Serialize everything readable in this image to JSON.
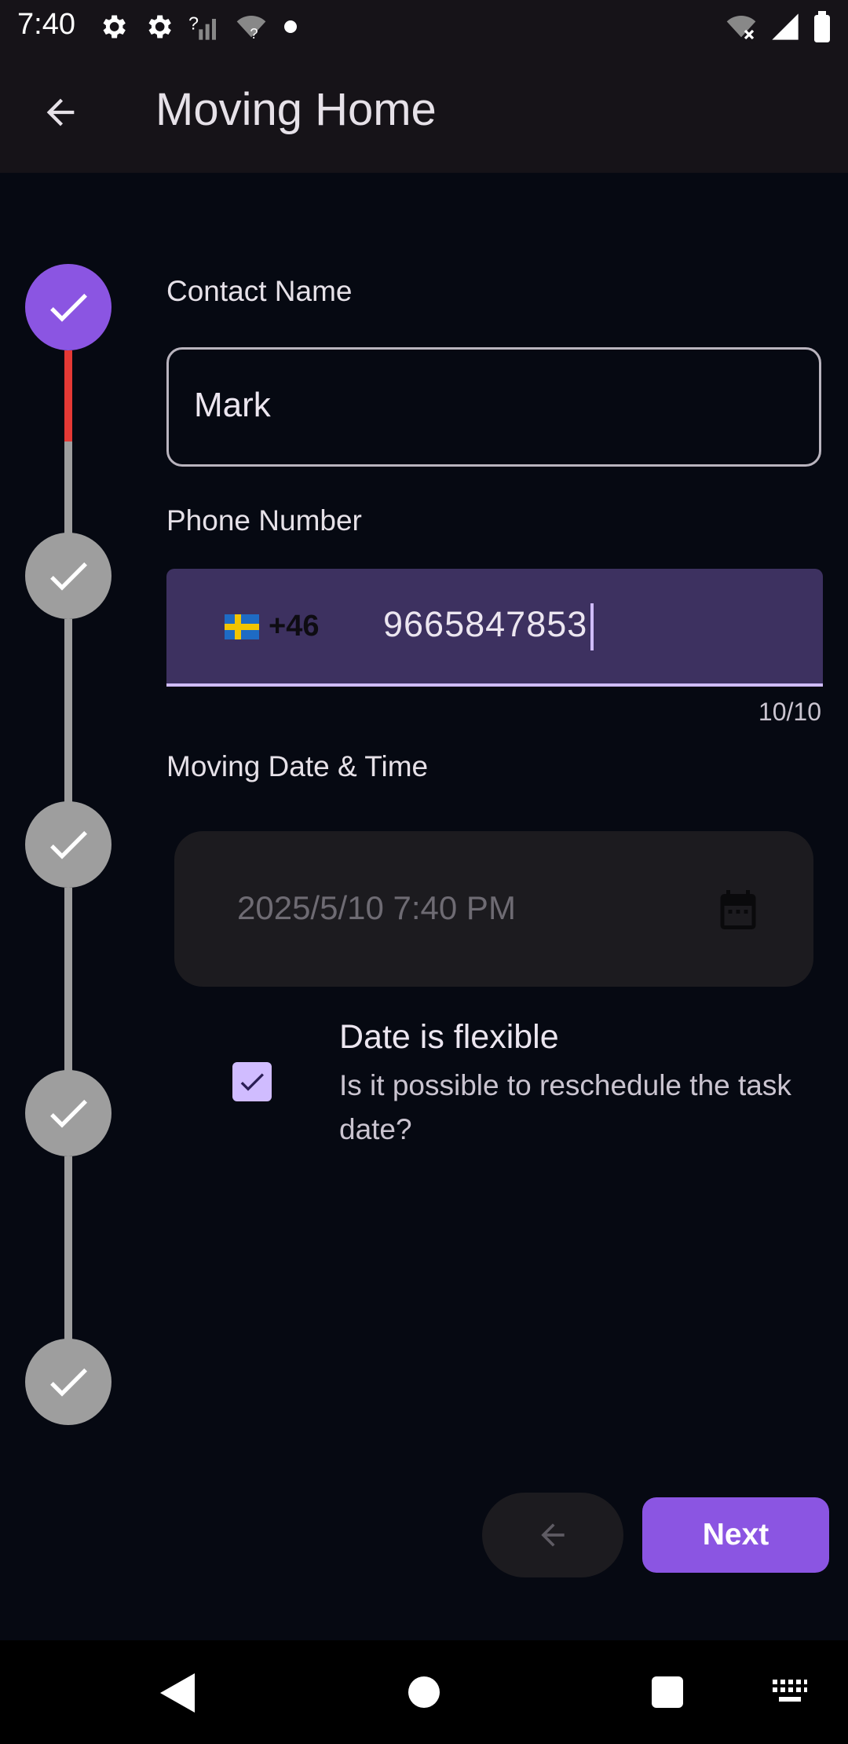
{
  "status_bar": {
    "time": "7:40",
    "icons_left": [
      "gear-icon",
      "gear-icon",
      "signal-unknown-icon",
      "wifi-unknown-icon",
      "dot-icon"
    ],
    "icons_right": [
      "wifi-off-icon",
      "cell-signal-icon",
      "battery-icon"
    ]
  },
  "app_bar": {
    "title": "Moving Home",
    "back_icon": "arrow-left-icon"
  },
  "stepper": {
    "steps": [
      {
        "state": "active"
      },
      {
        "state": "done"
      },
      {
        "state": "done"
      },
      {
        "state": "done"
      },
      {
        "state": "done"
      }
    ]
  },
  "form": {
    "contact_name": {
      "label": "Contact Name",
      "value": "Mark"
    },
    "phone": {
      "label": "Phone Number",
      "country_flag": "sweden-flag",
      "country_code": "+46",
      "value": "9665847853",
      "counter": "10/10"
    },
    "moving_date": {
      "label": "Moving Date & Time",
      "value": "2025/5/10  7:40 PM",
      "icon": "calendar-icon"
    },
    "flexible": {
      "checked": true,
      "title": "Date is flexible",
      "subtitle": "Is it possible to reschedule the task date?"
    }
  },
  "actions": {
    "previous_icon": "arrow-left-icon",
    "next_label": "Next"
  },
  "colors": {
    "accent": "#8B55E2",
    "field_active_bg": "#3D3160",
    "progress_red": "#E53935",
    "background": "#060912"
  }
}
